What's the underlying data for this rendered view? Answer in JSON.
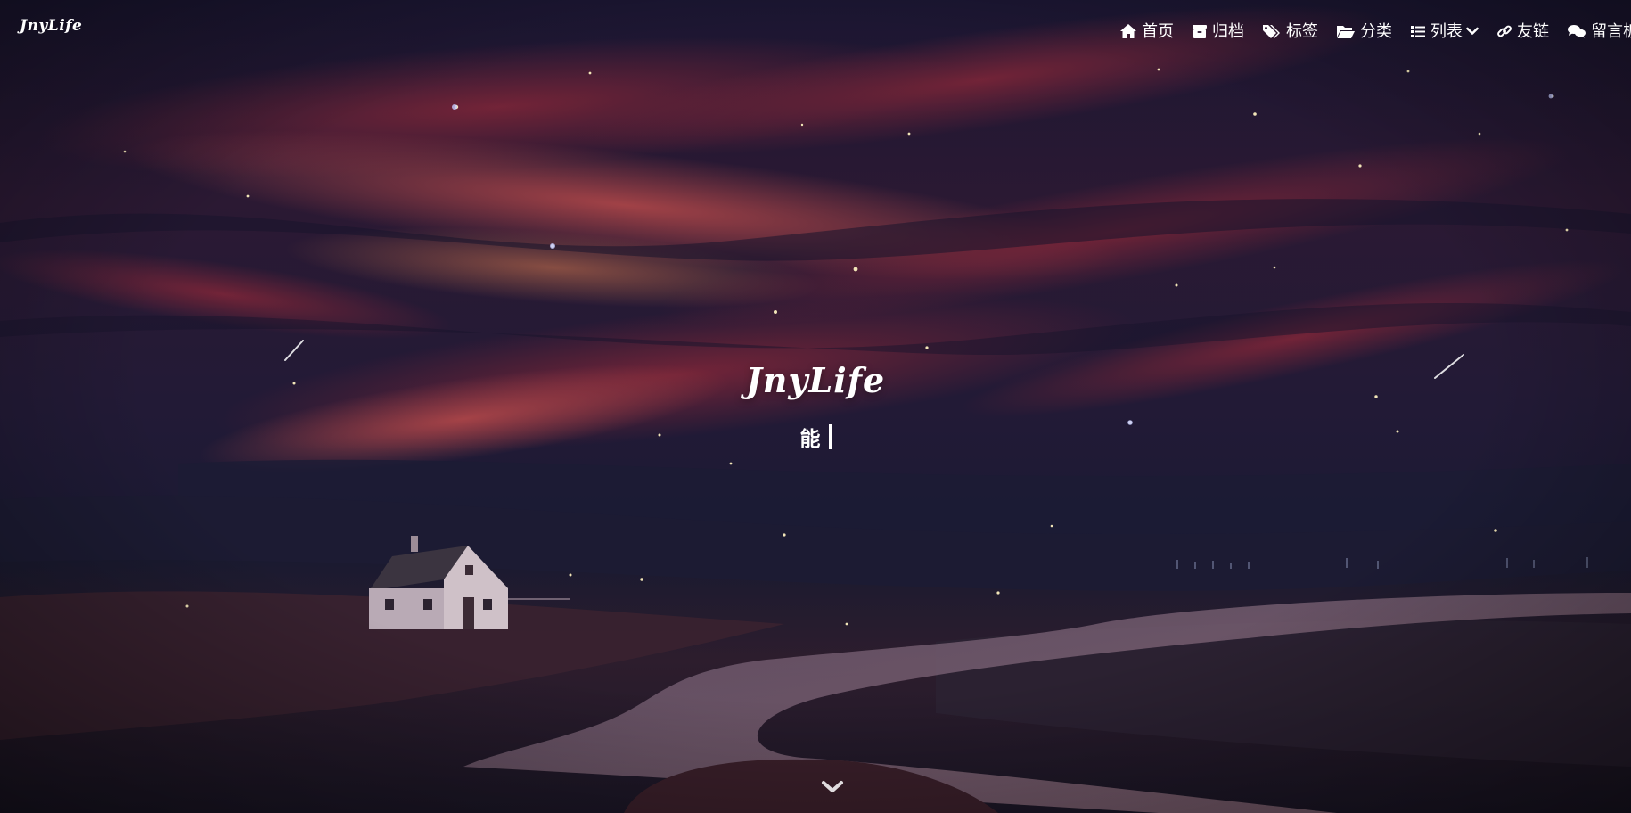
{
  "brand": "JnyLife",
  "nav": {
    "items": [
      {
        "icon": "home-icon",
        "label": "首页"
      },
      {
        "icon": "archive-icon",
        "label": "归档"
      },
      {
        "icon": "tags-icon",
        "label": "标签"
      },
      {
        "icon": "folder-open-icon",
        "label": "分类"
      },
      {
        "icon": "list-icon",
        "label": "列表"
      },
      {
        "icon": "link-icon",
        "label": "友链"
      },
      {
        "icon": "comments-icon",
        "label": "留言板"
      }
    ]
  },
  "hero": {
    "title": "JnyLife",
    "subtitle": "能"
  },
  "icons": {
    "scroll": "chevron-down-icon"
  },
  "colors": {
    "text": "#ffffff",
    "sky_dark": "#151532",
    "sky_red": "#8f2c3b",
    "ground": "#1b1a2d"
  }
}
